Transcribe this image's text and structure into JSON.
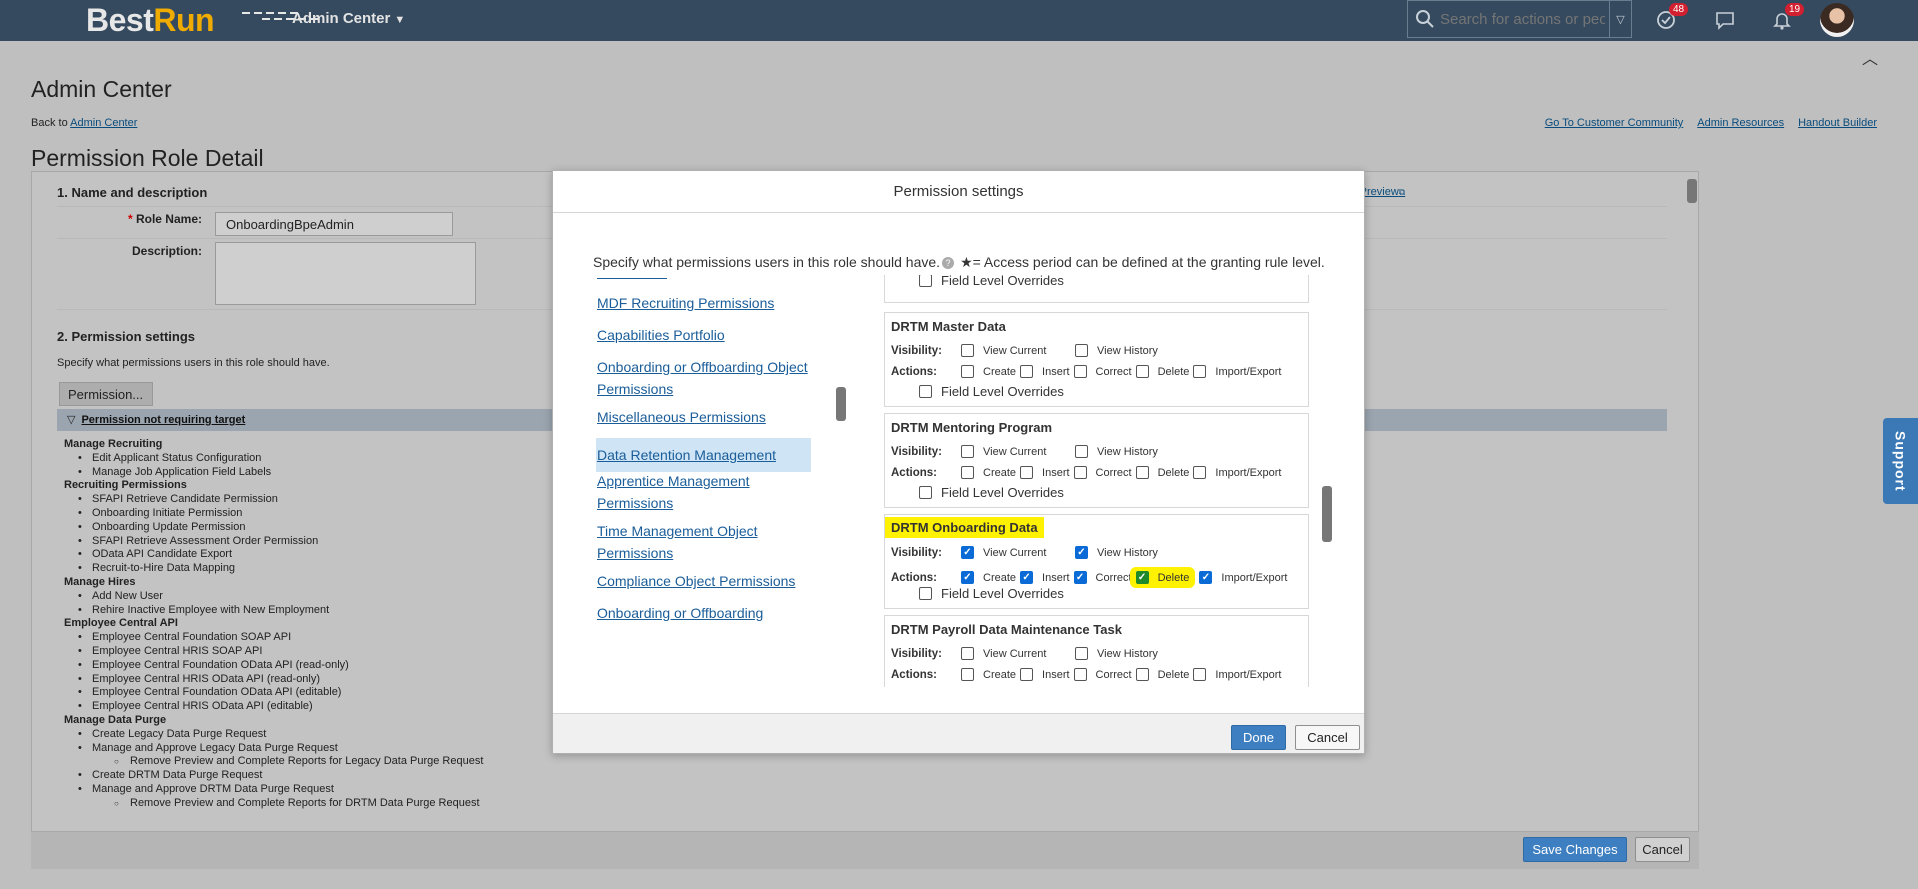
{
  "shell": {
    "logo_best": "Best",
    "logo_run": "Run",
    "menu_label": "Admin Center",
    "search_placeholder": "Search for actions or peo...",
    "todo_badge": "48",
    "notif_badge": "19"
  },
  "page": {
    "admin_title": "Admin Center",
    "back_prefix": "Back to ",
    "back_link": "Admin Center",
    "top_links": [
      "Go To Customer Community",
      "Admin Resources",
      "Handout Builder"
    ],
    "role_detail_title": "Permission Role Detail",
    "section1_title": "1. Name and description",
    "print_preview": "Print Preview",
    "role_name_label": "Role Name:",
    "role_name_value": "OnboardingBpeAdmin",
    "description_label": "Description:",
    "section2_title": "2. Permission settings",
    "section2_desc": "Specify what permissions users in this role should have.",
    "permission_button": "Permission...",
    "group_title": "Permission not requiring target",
    "save_changes": "Save Changes",
    "cancel": "Cancel",
    "support": "Support",
    "perm_tree": [
      {
        "type": "cat",
        "text": "Manage Recruiting"
      },
      {
        "type": "it",
        "text": "Edit Applicant Status Configuration"
      },
      {
        "type": "it",
        "text": "Manage Job Application Field Labels"
      },
      {
        "type": "cat",
        "text": "Recruiting Permissions"
      },
      {
        "type": "it",
        "text": "SFAPI Retrieve Candidate Permission"
      },
      {
        "type": "it",
        "text": "Onboarding Initiate Permission"
      },
      {
        "type": "it",
        "text": "Onboarding Update Permission"
      },
      {
        "type": "it",
        "text": "SFAPI Retrieve Assessment Order Permission"
      },
      {
        "type": "it",
        "text": "OData API Candidate Export"
      },
      {
        "type": "it",
        "text": "Recruit-to-Hire Data Mapping"
      },
      {
        "type": "cat",
        "text": "Manage Hires"
      },
      {
        "type": "it",
        "text": "Add New User"
      },
      {
        "type": "it",
        "text": "Rehire Inactive Employee with New Employment"
      },
      {
        "type": "cat",
        "text": "Employee Central API"
      },
      {
        "type": "it",
        "text": "Employee Central Foundation SOAP API"
      },
      {
        "type": "it",
        "text": "Employee Central HRIS SOAP API"
      },
      {
        "type": "it",
        "text": "Employee Central Foundation OData API (read-only)"
      },
      {
        "type": "it",
        "text": "Employee Central HRIS OData API (read-only)"
      },
      {
        "type": "it",
        "text": "Employee Central Foundation OData API (editable)"
      },
      {
        "type": "it",
        "text": "Employee Central HRIS OData API (editable)"
      },
      {
        "type": "cat",
        "text": "Manage Data Purge"
      },
      {
        "type": "it",
        "text": "Create Legacy Data Purge Request"
      },
      {
        "type": "it",
        "text": "Manage and Approve Legacy Data Purge Request"
      },
      {
        "type": "sub",
        "text": "Remove Preview and Complete Reports for Legacy Data Purge Request"
      },
      {
        "type": "it",
        "text": "Create DRTM Data Purge Request"
      },
      {
        "type": "it",
        "text": "Manage and Approve DRTM Data Purge Request"
      },
      {
        "type": "sub",
        "text": "Remove Preview and Complete Reports for DRTM Data Purge Request"
      }
    ]
  },
  "dialog": {
    "title": "Permission settings",
    "intro": "Specify what permissions users in this role should have.",
    "intro_note": "★= Access period can be defined at the granting rule level.",
    "done": "Done",
    "cancel": "Cancel",
    "nav": [
      {
        "label": "MDF Recruiting Permissions",
        "selected": false
      },
      {
        "label": "Capabilities Portfolio",
        "selected": false
      },
      {
        "label": "Onboarding or Offboarding Object Permissions",
        "selected": false
      },
      {
        "label": "Miscellaneous Permissions",
        "selected": false
      },
      {
        "label": "Data Retention Management",
        "selected": true
      },
      {
        "label": "Apprentice Management Permissions",
        "selected": false
      },
      {
        "label": "Time Management Object Permissions",
        "selected": false
      },
      {
        "label": "Compliance Object Permissions",
        "selected": false
      },
      {
        "label": "Onboarding or Offboarding",
        "selected": false
      }
    ],
    "labels": {
      "visibility": "Visibility:",
      "actions": "Actions:",
      "view_current": "View Current",
      "view_history": "View History",
      "create": "Create",
      "insert": "Insert",
      "correct": "Correct",
      "delete": "Delete",
      "import_export": "Import/Export",
      "field_level_overrides": "Field Level Overrides"
    },
    "blocks": [
      {
        "title": "DRTM Master Data",
        "highlight": false,
        "view_current": false,
        "view_history": false,
        "create": false,
        "insert": false,
        "correct": false,
        "delete": false,
        "import_export": false,
        "field_level_overrides": false
      },
      {
        "title": "DRTM Mentoring Program",
        "highlight": false,
        "view_current": false,
        "view_history": false,
        "create": false,
        "insert": false,
        "correct": false,
        "delete": false,
        "import_export": false,
        "field_level_overrides": false
      },
      {
        "title": "DRTM Onboarding Data",
        "highlight": true,
        "view_current": true,
        "view_history": true,
        "create": true,
        "insert": true,
        "correct": true,
        "delete": true,
        "import_export": true,
        "field_level_overrides": false
      },
      {
        "title": "DRTM Payroll Data Maintenance Task",
        "highlight": false,
        "view_current": false,
        "view_history": false,
        "create": false,
        "insert": false,
        "correct": false,
        "delete": false,
        "import_export": false,
        "field_level_overrides": false
      }
    ]
  },
  "colors": {
    "shell_bg": "#354a5f",
    "accent": "#3d7fc0",
    "highlight": "#fff200",
    "link": "#1a5d99"
  }
}
